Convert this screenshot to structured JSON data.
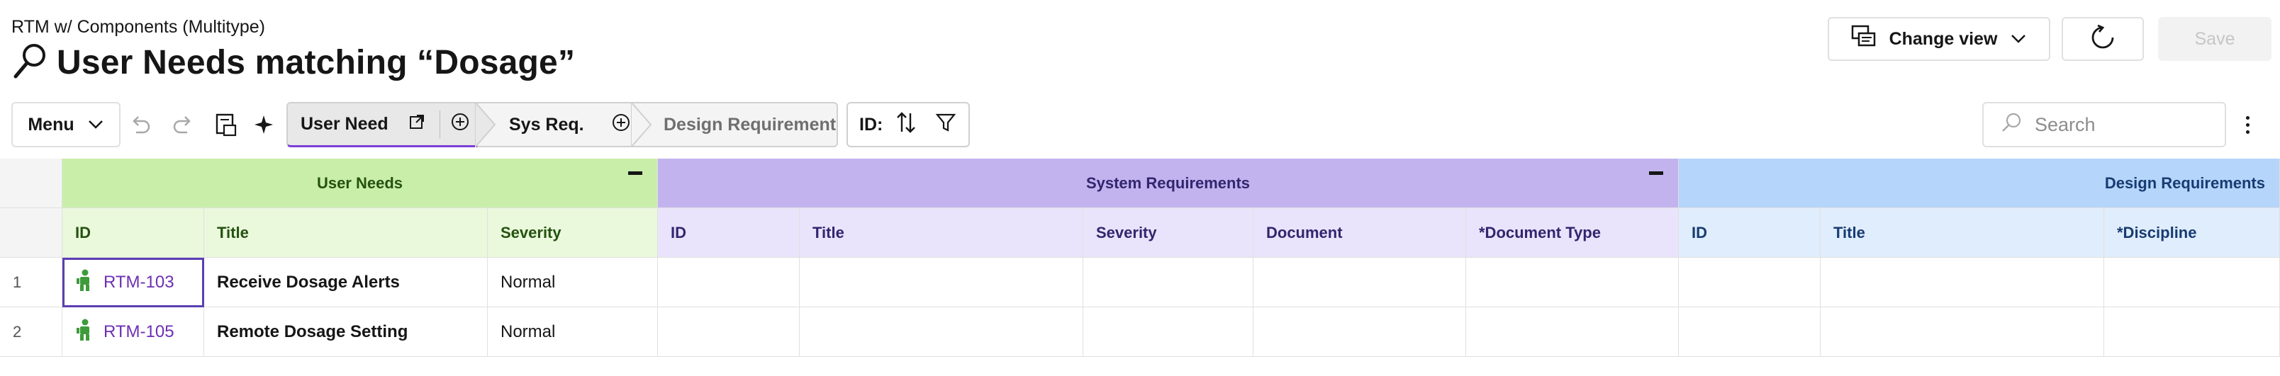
{
  "header": {
    "breadcrumb": "RTM w/ Components (Multitype)",
    "title": "User Needs matching “Dosage”",
    "change_view_label": "Change view",
    "save_label": "Save"
  },
  "toolbar": {
    "menu_label": "Menu",
    "levels": [
      {
        "label": "User Need"
      },
      {
        "label": "Sys Req."
      },
      {
        "label": "Design Requirement"
      }
    ],
    "sort_label": "ID:",
    "search_placeholder": "Search"
  },
  "table": {
    "groups": [
      {
        "label": "User Needs",
        "color": "#c9eeaa"
      },
      {
        "label": "System Requirements",
        "color": "#c2b3ef"
      },
      {
        "label": "Design Requirements",
        "color": "#b5d5fb"
      }
    ],
    "columns": {
      "user_needs": [
        "ID",
        "Title",
        "Severity"
      ],
      "system_requirements": [
        "ID",
        "Title",
        "Severity",
        "Document",
        "*Document Type"
      ],
      "design_requirements": [
        "ID",
        "Title",
        "*Discipline"
      ]
    },
    "rows": [
      {
        "num": "1",
        "id": "RTM-103",
        "title": "Receive Dosage Alerts",
        "severity": "Normal"
      },
      {
        "num": "2",
        "id": "RTM-105",
        "title": "Remote Dosage Setting",
        "severity": "Normal"
      }
    ]
  },
  "colors": {
    "accent": "#7a3fd6",
    "link": "#6d2fb5",
    "user_need_icon": "#3e9b3a"
  },
  "icons": [
    "search-icon",
    "change-view-icon",
    "chevron-down-icon",
    "refresh-icon",
    "undo-icon",
    "redo-icon",
    "save-local-icon",
    "sparkle-icon",
    "open-external-icon",
    "add-circle-icon",
    "sort-icon",
    "filter-icon",
    "kebab-icon",
    "user-need-icon"
  ]
}
